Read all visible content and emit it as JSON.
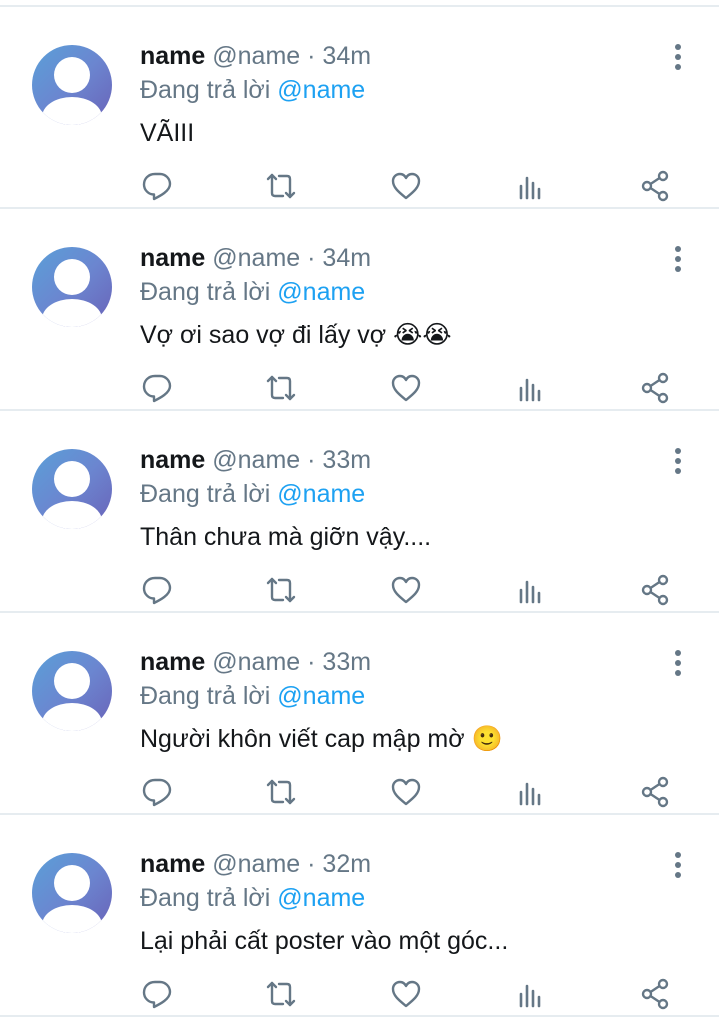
{
  "ui": {
    "reply_prefix": "Đang trả lời",
    "icons": {
      "more": "more-vertical-icon",
      "reply": "reply-icon",
      "retweet": "retweet-icon",
      "like": "heart-icon",
      "stats": "analytics-icon",
      "share": "share-icon"
    },
    "colors": {
      "text": "#14171a",
      "secondary": "#657786",
      "mention": "#1da1f2",
      "divider": "#e6ecf0"
    }
  },
  "tweets": [
    {
      "name": "name",
      "handle": "@name",
      "separator": "·",
      "time": "34m",
      "reply_to": "@name",
      "text": "VÃIII"
    },
    {
      "name": "name",
      "handle": "@name",
      "separator": "·",
      "time": "34m",
      "reply_to": "@name",
      "text": "Vợ ơi sao vợ đi lấy vợ 😭😭"
    },
    {
      "name": "name",
      "handle": "@name",
      "separator": "·",
      "time": "33m",
      "reply_to": "@name",
      "text": "Thân chưa mà giỡn vậy...."
    },
    {
      "name": "name",
      "handle": "@name",
      "separator": "·",
      "time": "33m",
      "reply_to": "@name",
      "text": "Người khôn viết cap mập mờ 🙂"
    },
    {
      "name": "name",
      "handle": "@name",
      "separator": "·",
      "time": "32m",
      "reply_to": "@name",
      "text": "Lại phải cất poster vào một góc..."
    }
  ]
}
